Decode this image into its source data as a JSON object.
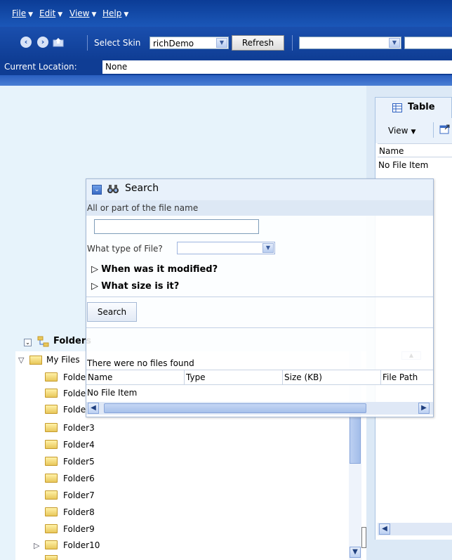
{
  "menu": {
    "items": [
      {
        "label": "File"
      },
      {
        "label": "Edit"
      },
      {
        "label": "View"
      },
      {
        "label": "Help"
      }
    ]
  },
  "toolbar": {
    "skin_label": "Select Skin",
    "skin_value": "richDemo",
    "refresh_label": "Refresh",
    "second_select_value": ""
  },
  "location": {
    "label": "Current Location:",
    "value": "None"
  },
  "table_panel": {
    "tab_label": "Table",
    "view_label": "View",
    "column_name": "Name",
    "empty_text": "No File Item"
  },
  "search": {
    "title": "Search",
    "filename_label": "All or part of the file name",
    "filename_value": "",
    "type_label": "What type of File?",
    "type_value": "",
    "modified_label": "When was it modified?",
    "size_label": "What size is it?",
    "search_button": "Search",
    "result_message": "There were no files found",
    "columns": [
      "Name",
      "Type",
      "Size (KB)",
      "File Path"
    ],
    "empty_row": "No File Item"
  },
  "folders": {
    "title": "Folders",
    "root": "My Files",
    "items": [
      {
        "label": "Folde"
      },
      {
        "label": "Folde"
      },
      {
        "label": "Folde"
      },
      {
        "label": "Folder3"
      },
      {
        "label": "Folder4"
      },
      {
        "label": "Folder5"
      },
      {
        "label": "Folder6"
      },
      {
        "label": "Folder7"
      },
      {
        "label": "Folder8"
      },
      {
        "label": "Folder9"
      },
      {
        "label": "Folder10"
      }
    ]
  },
  "colors": {
    "menubar": "#0b3c96",
    "toolbar": "#1a4fae",
    "pane_background": "#e7f3fb"
  }
}
